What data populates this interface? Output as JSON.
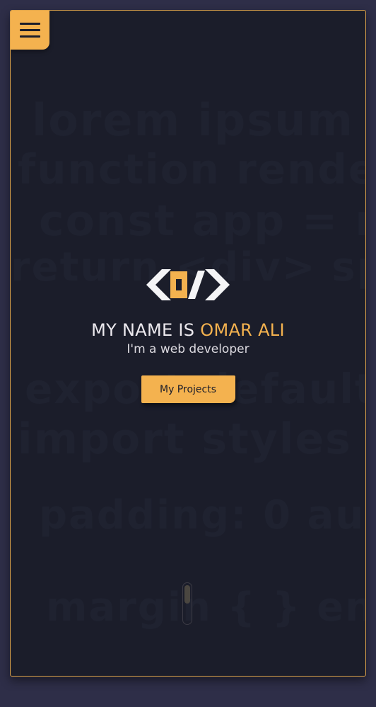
{
  "menu": {
    "icon": "hamburger-menu-icon"
  },
  "logo": {
    "icon": "code-brackets-logo-icon",
    "colors": {
      "brackets": "#f4f4f6",
      "accent": "#f4b24f"
    }
  },
  "hero": {
    "name_prefix": "MY NAME IS ",
    "name_highlight": "OMAR ALI",
    "subtitle": "I'm a web developer",
    "cta_label": "My Projects"
  },
  "scroll": {
    "icon": "mouse-scroll-icon"
  },
  "colors": {
    "accent": "#f4b24f",
    "background": "#1b1d2a",
    "page": "#2e2e48",
    "text": "#ece9ee"
  }
}
